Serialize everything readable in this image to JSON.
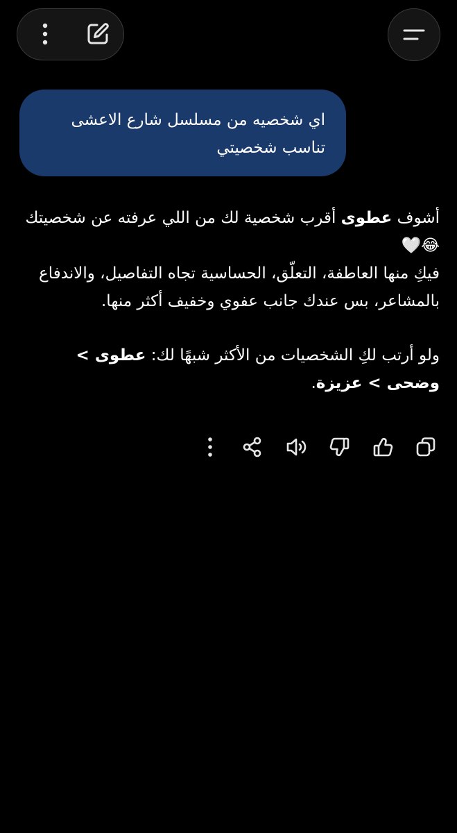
{
  "header": {
    "more_icon": "more-vertical-icon",
    "edit_icon": "edit-icon",
    "menu_icon": "menu-icon"
  },
  "user_message": {
    "text": "اي شخصيه من مسلسل شارع الاعشى تناسب شخصيتي"
  },
  "assistant_message": {
    "para1_prefix": "أشوف ",
    "para1_bold": "عطوى",
    "para1_rest": " أقرب شخصية لك من اللي عرفته عن شخصيتك",
    "para1_emoji": "😂🤍",
    "para2": "فيكِ منها العاطفة، التعلّق، الحساسية تجاه التفاصيل، والاندفاع بالمشاعر، بس عندك جانب عفوي وخفيف أكثر منها.",
    "para3_prefix": "ولو أرتب لكِ الشخصيات من الأكثر شبهًا لك: ",
    "para3_bold": "عطوى > وضحى > عزيزة",
    "para3_end": "."
  },
  "actions": [
    {
      "name": "copy-icon"
    },
    {
      "name": "thumbs-up-icon"
    },
    {
      "name": "thumbs-down-icon"
    },
    {
      "name": "speaker-icon"
    },
    {
      "name": "share-icon"
    },
    {
      "name": "more-vertical-icon"
    }
  ],
  "colors": {
    "background": "#000000",
    "bubble": "#1a3a6b",
    "icon": "#e6e6e6",
    "pill": "#151515"
  }
}
